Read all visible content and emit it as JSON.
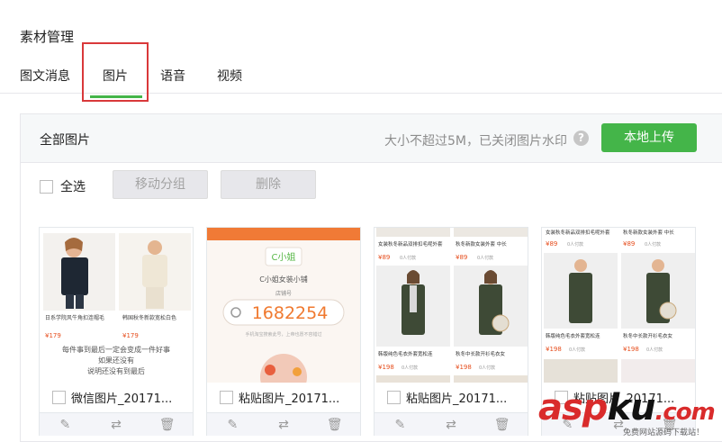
{
  "page_title": "素材管理",
  "tabs": [
    {
      "label": "图文消息",
      "active": false
    },
    {
      "label": "图片",
      "active": true
    },
    {
      "label": "语音",
      "active": false
    },
    {
      "label": "视频",
      "active": false
    }
  ],
  "panel": {
    "group_name": "全部图片",
    "tip": "大小不超过5M，已关闭图片水印",
    "help_icon": "?",
    "upload_label": "本地上传"
  },
  "toolbar": {
    "select_all": "全选",
    "move_label": "移动分组",
    "delete_label": "删除"
  },
  "cards": [
    {
      "name": "微信图片_20171...",
      "captions": [
        "日系学院风牛角扣连帽毛",
        "韩国秋冬新款宽松白色",
        "每件事到最后一定会变成一件好事",
        "如果还没有",
        "说明还没有到最后"
      ],
      "prices": [
        "¥179",
        "¥179"
      ]
    },
    {
      "name": "粘贴图片_20171...",
      "logo": "C小姐",
      "shop": "C小姐女装小铺",
      "shop_sub": "店铺号",
      "number": "1682254",
      "hint": "手机淘宝搜索此号，上帝也愿不容错过"
    },
    {
      "name": "粘贴图片_20171...",
      "captions": [
        "女装秋冬新品双排扣毛呢外套",
        "秋冬新款女装外套 中长",
        "韩版纯色毛衣外套宽松连",
        "秋冬中长款开衫毛衣女"
      ],
      "prices": [
        "¥89",
        "¥89",
        "¥198",
        "¥198"
      ],
      "sold": [
        "0人付款",
        "0人付款",
        "0人付款",
        "0人付款"
      ]
    },
    {
      "name": "粘贴图片_20171...",
      "captions": [
        "女装秋冬新品双排扣毛呢外套",
        "秋冬新款女装外套 中长",
        "韩版纯色毛衣外套宽松连",
        "秋冬中长款开衫毛衣女"
      ],
      "prices": [
        "¥89",
        "¥89",
        "¥198",
        "¥198"
      ],
      "sold": [
        "0人付款",
        "0人付款",
        "0人付款",
        "0人付款"
      ]
    }
  ],
  "watermark": {
    "text_a": "asp",
    "text_b": "ku",
    "text_c": ".com",
    "sub": "免费网站源码下载站！"
  },
  "colors": {
    "accent": "#44b549",
    "highlight": "#d9383a"
  }
}
